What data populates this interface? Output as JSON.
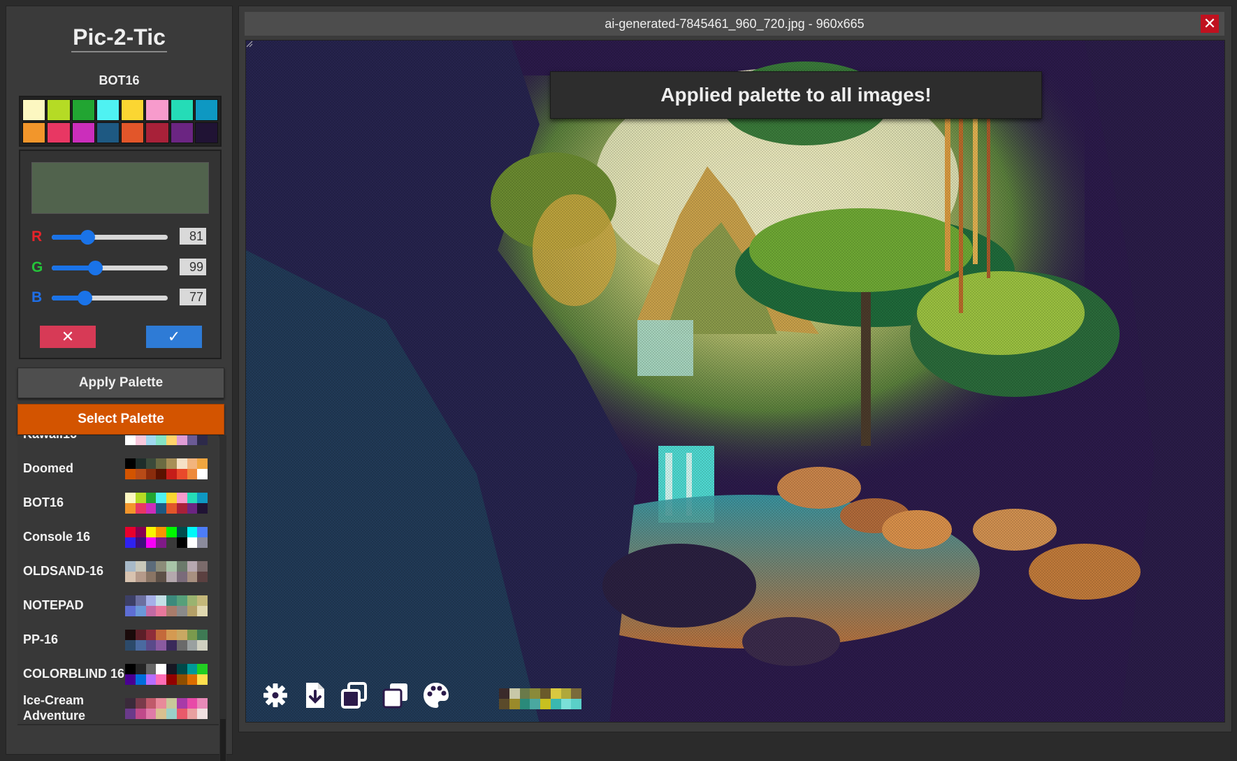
{
  "app": {
    "title": "Pic-2-Tic"
  },
  "palette": {
    "name": "BOT16",
    "colors": [
      "#fcf7c1",
      "#b5db25",
      "#22a532",
      "#4ff2f2",
      "#fbd632",
      "#f79bcc",
      "#25dcb7",
      "#0e98c2",
      "#f2962b",
      "#e83763",
      "#cb2ebb",
      "#1e5982",
      "#e2562a",
      "#a82139",
      "#6b2582",
      "#201334"
    ]
  },
  "editor": {
    "preview_color": "#51634d",
    "r_label": "R",
    "g_label": "G",
    "b_label": "B",
    "r_value": "81",
    "g_value": "99",
    "b_value": "77",
    "r_color": "#e8232a",
    "g_color": "#24c43a",
    "b_color": "#1f6fe8",
    "cancel_label": "✕",
    "confirm_label": "✓"
  },
  "buttons": {
    "apply": "Apply Palette",
    "select": "Select Palette"
  },
  "palette_list": [
    {
      "name": "Kawaii16",
      "colors": [
        "#f5a623",
        "#fce38a",
        "#b6e3a6",
        "#7ecfe7",
        "#c9a7f5",
        "#f3a1e6",
        "#4a4e8f",
        "#1d1b2e",
        "#ffffff",
        "#f8c8dc",
        "#a0d8ef",
        "#85e3c5",
        "#ffd46b",
        "#e09dd6",
        "#6b5b95",
        "#2d2a4a"
      ]
    },
    {
      "name": "Doomed",
      "colors": [
        "#000000",
        "#1e2d2a",
        "#3b4a3a",
        "#6b6b42",
        "#a88f57",
        "#f5e1c6",
        "#f2b47d",
        "#f0a640",
        "#d35400",
        "#b84b17",
        "#8a2c0c",
        "#5a1200",
        "#c51d19",
        "#e94a2b",
        "#ee8a3b",
        "#ffffff"
      ]
    },
    {
      "name": "BOT16",
      "colors": [
        "#fcf7c1",
        "#b5db25",
        "#22a532",
        "#4ff2f2",
        "#fbd632",
        "#f79bcc",
        "#25dcb7",
        "#0e98c2",
        "#f2962b",
        "#e83763",
        "#cb2ebb",
        "#1e5982",
        "#e2562a",
        "#a82139",
        "#6b2582",
        "#201334"
      ]
    },
    {
      "name": "Console 16",
      "colors": [
        "#e8002d",
        "#880050",
        "#f8f400",
        "#f99400",
        "#00f800",
        "#004c4c",
        "#00f8f8",
        "#4d7df8",
        "#2f22f0",
        "#3c0f7a",
        "#f800f8",
        "#7f1a88",
        "#3a3a3a",
        "#000000",
        "#ffffff",
        "#8b8b9c"
      ]
    },
    {
      "name": "OLDSAND-16",
      "colors": [
        "#a7b9c8",
        "#c9c8ba",
        "#5c6b7a",
        "#8c8c79",
        "#a8c5a8",
        "#6b7a6b",
        "#b7a8b0",
        "#7b6b6b",
        "#d8c3b0",
        "#b59a8a",
        "#8a7565",
        "#5d5047",
        "#b4a8ad",
        "#7a6b7a",
        "#a89080",
        "#5b4040"
      ]
    },
    {
      "name": "NOTEPAD",
      "colors": [
        "#3c3f66",
        "#6b6fa0",
        "#a6b0e8",
        "#c4e0e7",
        "#3c8a7c",
        "#56a07a",
        "#9ab370",
        "#c4b87a",
        "#5e6ed4",
        "#6a98d8",
        "#c26aa4",
        "#e8789c",
        "#a97c6b",
        "#8a8a8a",
        "#b4a068",
        "#e0d8b0"
      ]
    },
    {
      "name": "PP-16",
      "colors": [
        "#1a0a0a",
        "#5c1f28",
        "#8f2d3a",
        "#c46a3b",
        "#d49a52",
        "#c8a862",
        "#7a9a4d",
        "#3e7a54",
        "#2c4a6a",
        "#4a6aa0",
        "#5a4a8a",
        "#8a5aa0",
        "#3a2a5a",
        "#6a6a6a",
        "#9aa0a0",
        "#d0d0c0"
      ]
    },
    {
      "name": "COLORBLIND 16",
      "colors": [
        "#000000",
        "#252525",
        "#676767",
        "#ffffff",
        "#171723",
        "#004949",
        "#009999",
        "#22cf22",
        "#490092",
        "#006ddb",
        "#b66dff",
        "#ff6db6",
        "#920000",
        "#8f4e00",
        "#db6d00",
        "#ffdf4d"
      ]
    },
    {
      "name": "Ice-Cream Adventure",
      "colors": [
        "#3a2a3a",
        "#7a3a4a",
        "#c05a6a",
        "#e88a9a",
        "#c8c89a",
        "#a83aa8",
        "#e84aa8",
        "#e88ab8",
        "#6a3a8a",
        "#c04a8a",
        "#e07aa8",
        "#d8c090",
        "#9ad0c8",
        "#e85a6a",
        "#e8a0a0",
        "#f0e0e0"
      ]
    }
  ],
  "viewer": {
    "title": "ai-generated-7845461_960_720.jpg - 960x665",
    "close_label": "✕",
    "toast": "Applied palette to all images!",
    "image_palette": [
      "#3a2a2a",
      "#c8c8a8",
      "#6a7a4a",
      "#8a8a3a",
      "#6a5a2a",
      "#d8c840",
      "#b0a83a",
      "#7a6a3a",
      "#5a4a2a",
      "#9a8a2a",
      "#2a8a7a",
      "#4aa8a0",
      "#c8c020",
      "#3ab8b0",
      "#7ae0d8",
      "#5ad0c8"
    ]
  }
}
